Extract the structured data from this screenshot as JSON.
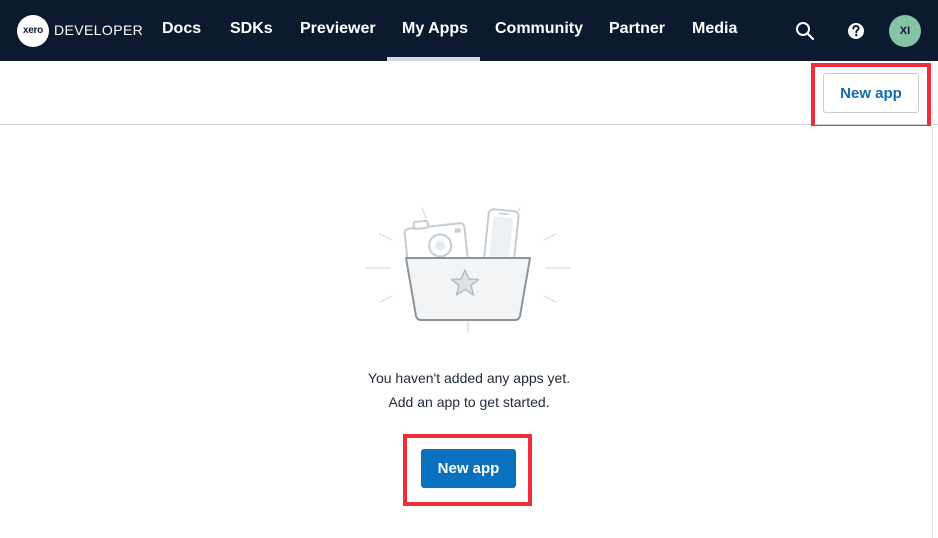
{
  "nav": {
    "logo_text": "xero",
    "brand": "DEVELOPER",
    "items": [
      {
        "label": "Docs"
      },
      {
        "label": "SDKs"
      },
      {
        "label": "Previewer"
      },
      {
        "label": "My Apps",
        "active": true
      },
      {
        "label": "Community"
      },
      {
        "label": "Partner"
      },
      {
        "label": "Media"
      }
    ],
    "icons": [
      "search-icon",
      "help-icon"
    ],
    "avatar_initials": "XI"
  },
  "header": {
    "new_app_label": "New app"
  },
  "empty_state": {
    "illustration": "folder-with-camera-and-phone-icon",
    "line1": "You haven't added any apps yet.",
    "line2": "Add an app to get started.",
    "cta_label": "New app"
  },
  "colors": {
    "nav_bg": "#0b1a2e",
    "primary": "#0a70c0",
    "link": "#0b6cb3",
    "avatar": "#85c3a4",
    "highlight": "#ee2e3b"
  }
}
